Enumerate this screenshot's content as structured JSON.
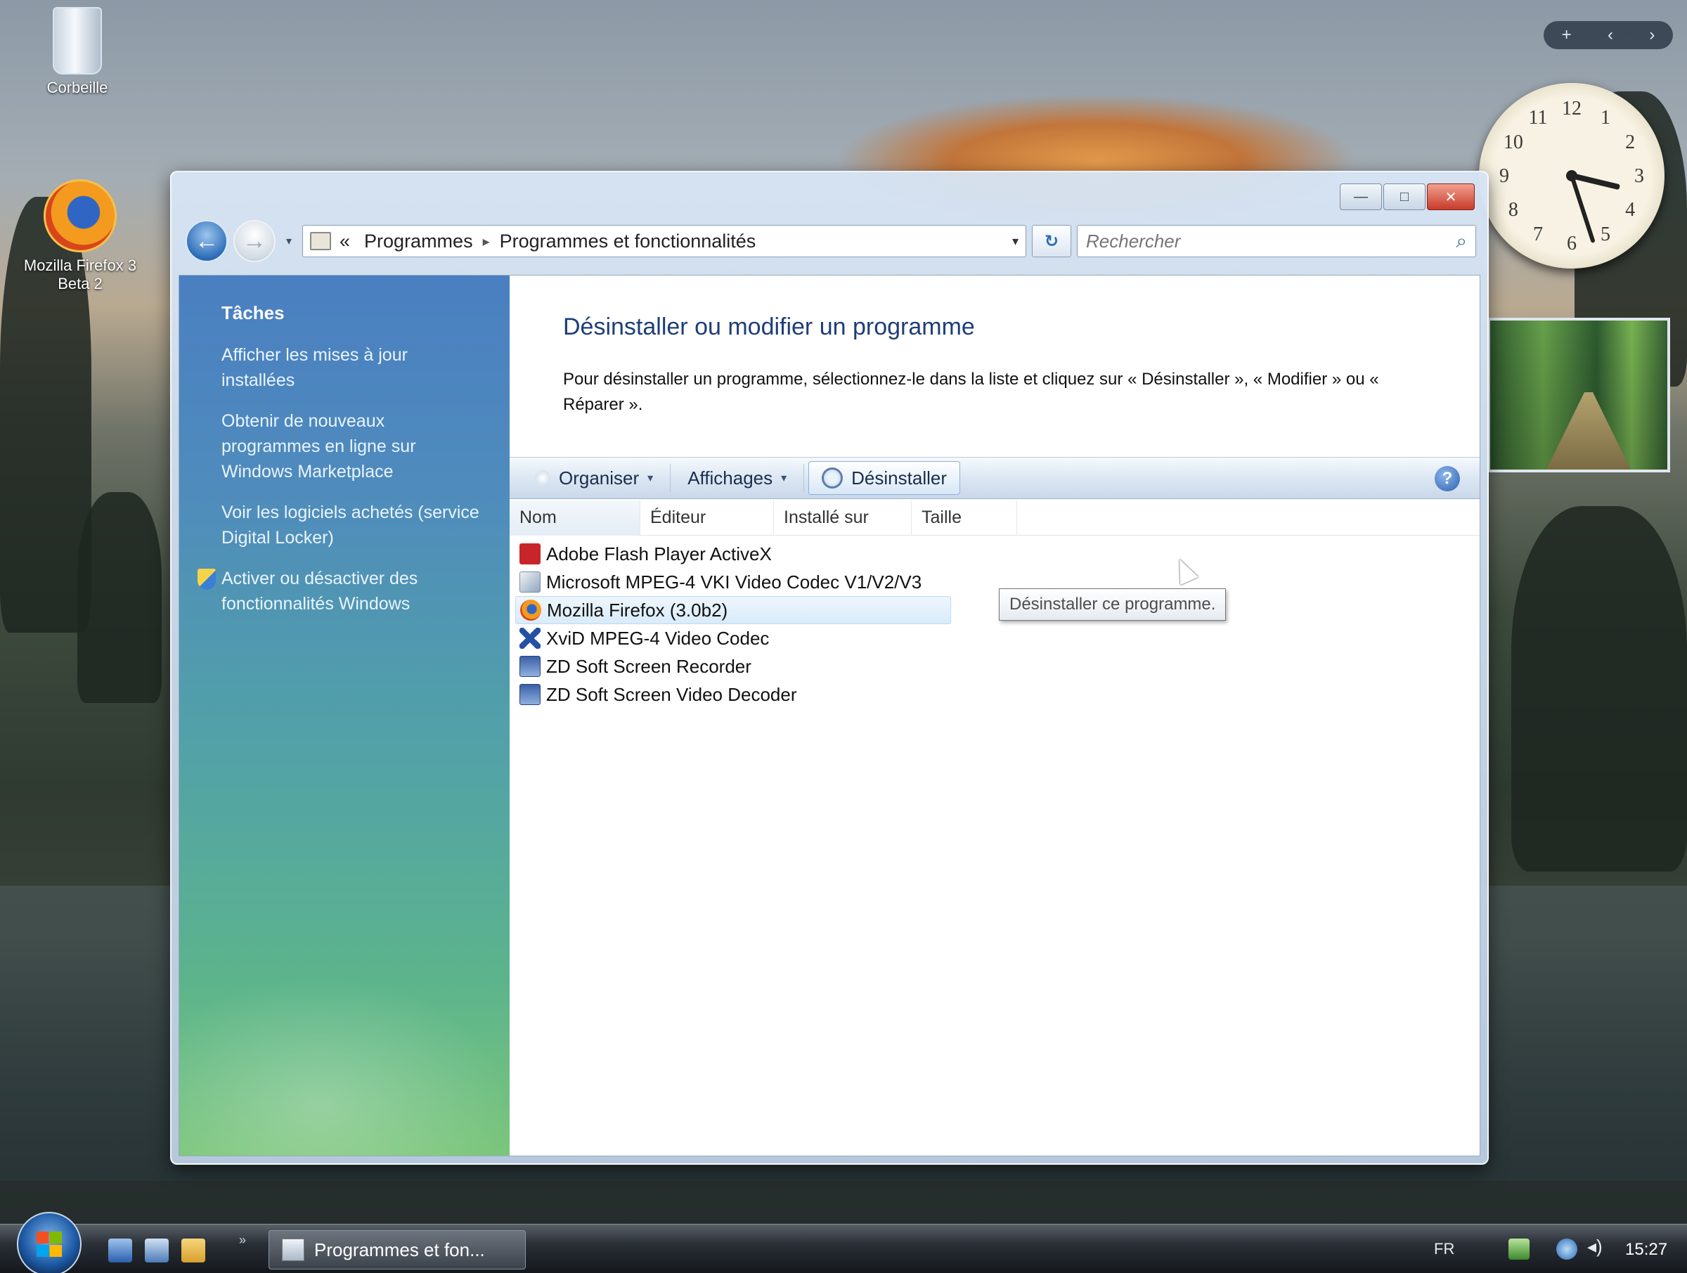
{
  "desktop": {
    "icons": [
      {
        "label": "Corbeille",
        "icon": "recycle-bin-icon"
      },
      {
        "label": "Mozilla Firefox 3 Beta 2",
        "icon": "firefox-icon"
      }
    ]
  },
  "gadgets": {
    "toolbar": {
      "add": "+",
      "prev": "‹",
      "next": "›"
    },
    "clock_numbers": [
      "12",
      "1",
      "2",
      "3",
      "4",
      "5",
      "6",
      "7",
      "8",
      "9",
      "10",
      "11"
    ],
    "clock_time": {
      "hour": 15,
      "minute": 27
    }
  },
  "window": {
    "caption": {
      "minimize": "—",
      "maximize": "□",
      "close": "✕"
    },
    "nav": {
      "back": "←",
      "forward": "→",
      "history": "▾"
    },
    "address": {
      "prefix": "«",
      "breadcrumb": [
        "Programmes",
        "Programmes et fonctionnalités"
      ],
      "separator": "▸",
      "dropdown": "▾"
    },
    "refresh": "↻",
    "search": {
      "placeholder": "Rechercher",
      "icon": "⌕"
    },
    "tasks": {
      "heading": "Tâches",
      "links": [
        "Afficher les mises à jour installées",
        "Obtenir de nouveaux programmes en ligne sur Windows Marketplace",
        "Voir les logiciels achetés (service Digital Locker)",
        "Activer ou désactiver des fonctionnalités Windows"
      ]
    },
    "main": {
      "title": "Désinstaller ou modifier un programme",
      "description": "Pour désinstaller un programme, sélectionnez-le dans la liste et cliquez sur « Désinstaller », « Modifier » ou « Réparer ».",
      "toolbar": {
        "organize": "Organiser",
        "views": "Affichages",
        "uninstall": "Désinstaller",
        "chevron": "▾",
        "help": "?"
      },
      "tooltip": "Désinstaller ce programme.",
      "columns": [
        "Nom",
        "Éditeur",
        "Installé sur",
        "Taille"
      ],
      "programs": [
        {
          "name": "Adobe Flash Player ActiveX",
          "icon": "flash-icon"
        },
        {
          "name": "Microsoft MPEG-4 VKI Video Codec V1/V2/V3",
          "icon": "media-codec-icon"
        },
        {
          "name": "Mozilla Firefox (3.0b2)",
          "icon": "firefox-icon",
          "selected": true
        },
        {
          "name": "XviD MPEG-4 Video Codec",
          "icon": "xvid-icon"
        },
        {
          "name": "ZD Soft Screen Recorder",
          "icon": "zd-soft-icon"
        },
        {
          "name": "ZD Soft Screen Video Decoder",
          "icon": "zd-soft-icon"
        }
      ]
    }
  },
  "taskbar": {
    "quicklaunch_more": "»",
    "task_button": "Programmes et fon...",
    "language": "FR",
    "volume": "◂)",
    "clock": "15:27"
  }
}
